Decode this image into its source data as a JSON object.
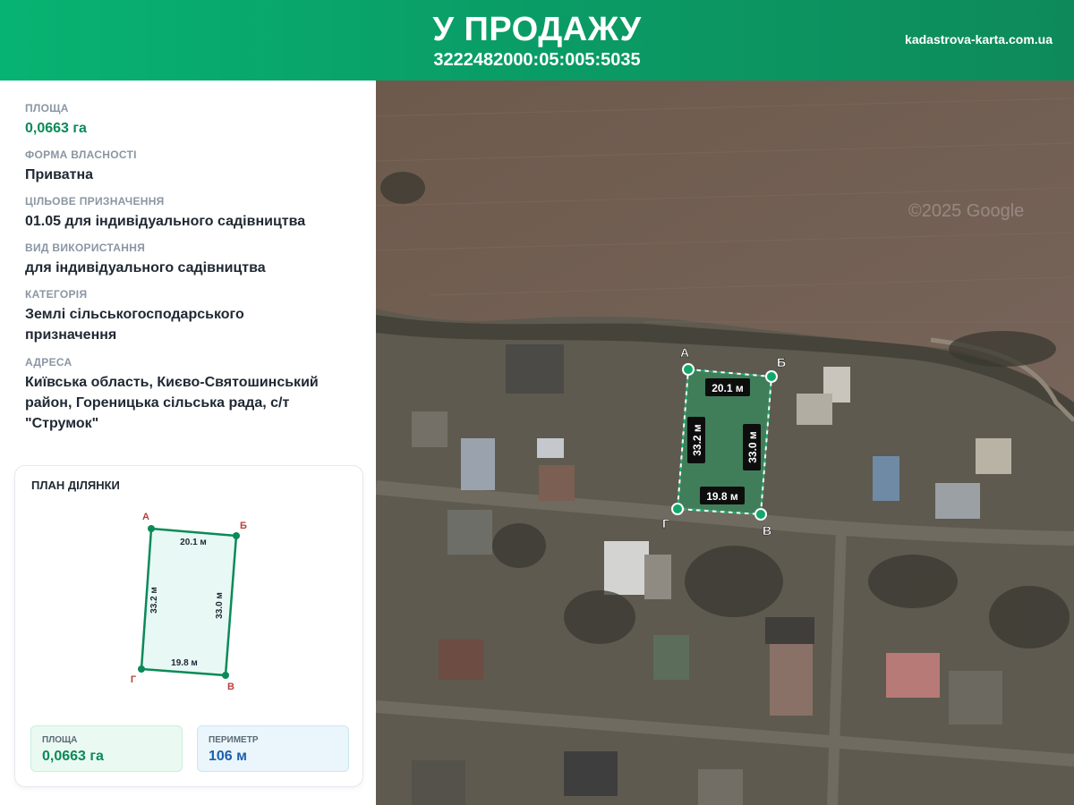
{
  "header": {
    "title": "У ПРОДАЖУ",
    "cadastral": "3222482000:05:005:5035",
    "site": "kadastrova-karta.com.ua"
  },
  "info": {
    "area": {
      "label": "ПЛОЩА",
      "value": "0,0663 га"
    },
    "ownership": {
      "label": "ФОРМА ВЛАСНОСТІ",
      "value": "Приватна"
    },
    "purpose": {
      "label": "ЦІЛЬОВЕ ПРИЗНАЧЕННЯ",
      "value": "01.05 для індивідуального садівництва"
    },
    "usage": {
      "label": "ВИД ВИКОРИСТАННЯ",
      "value": "для індивідуального садівництва"
    },
    "category": {
      "label": "КАТЕГОРІЯ",
      "value_line1": "Землі сільськогосподарського",
      "value_line2": "призначення"
    },
    "address": {
      "label": "АДРЕСА",
      "value_line1": "Київська область, Києво-Святошинський",
      "value_line2": "район, Гореницька сільська рада, с/т",
      "value_line3": "\"Струмок\""
    }
  },
  "plan": {
    "title": "ПЛАН ДІЛЯНКИ",
    "vertices": {
      "a": "А",
      "b": "Б",
      "v": "В",
      "g": "Г"
    },
    "sides": {
      "top": "20.1 м",
      "left": "33.2 м",
      "right": "33.0 м",
      "bottom": "19.8 м"
    },
    "stats": {
      "area_label": "ПЛОЩА",
      "area_value": "0,0663 га",
      "perimeter_label": "ПЕРИМЕТР",
      "perimeter_value": "106 м"
    }
  },
  "map": {
    "watermark": "©2025 Google",
    "vertices": {
      "a": "А",
      "b": "Б",
      "v": "В",
      "g": "Г"
    },
    "sides": {
      "top": "20.1 м",
      "left": "33.2 м",
      "right": "33.0 м",
      "bottom": "19.8 м"
    }
  },
  "colors": {
    "accent_green": "#0a8a58",
    "header_green": "#07b372",
    "vertex_red": "#b8403c",
    "perimeter_blue": "#1c5fb0"
  }
}
